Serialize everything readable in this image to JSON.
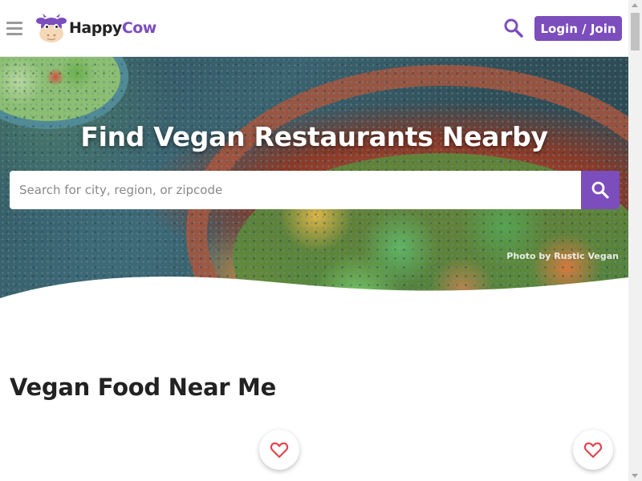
{
  "header": {
    "logo_text_part1": "Happy",
    "logo_text_part2": "Cow",
    "login_label": "Login / Join"
  },
  "hero": {
    "title": "Find Vegan Restaurants Nearby",
    "search_placeholder": "Search for city, region, or zipcode",
    "photo_credit": "Photo by Rustic Vegan"
  },
  "main": {
    "section_title": "Vegan Food Near Me"
  },
  "icons": {
    "menu": "hamburger-icon",
    "search": "search-icon",
    "favorite": "heart-icon"
  },
  "colors": {
    "brand_purple": "#7c4dbc",
    "heart_red": "#e0464f"
  }
}
